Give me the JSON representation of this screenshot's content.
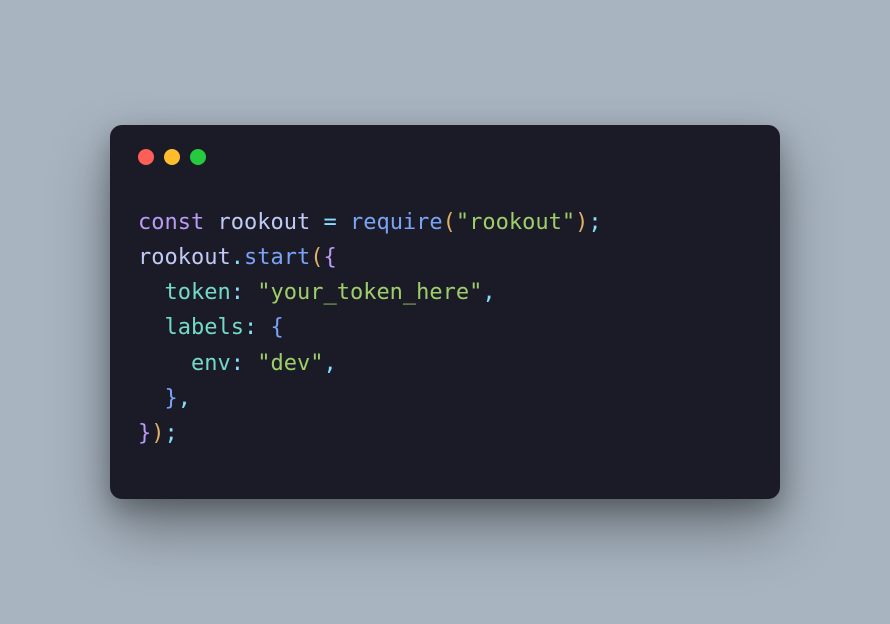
{
  "code": {
    "keyword_const": "const",
    "var_rookout": "rookout",
    "op_assign": "=",
    "fn_require": "require",
    "str_module": "\"rookout\"",
    "fn_start": "start",
    "prop_token": "token",
    "str_token": "\"your_token_here\"",
    "prop_labels": "labels",
    "prop_env": "env",
    "str_env": "\"dev\"",
    "paren_open": "(",
    "paren_close": ")",
    "brace_open": "{",
    "brace_close": "}",
    "colon": ":",
    "comma": ",",
    "dot": ".",
    "semi": ";",
    "indent1": "  ",
    "indent2": "    ",
    "space": " "
  }
}
